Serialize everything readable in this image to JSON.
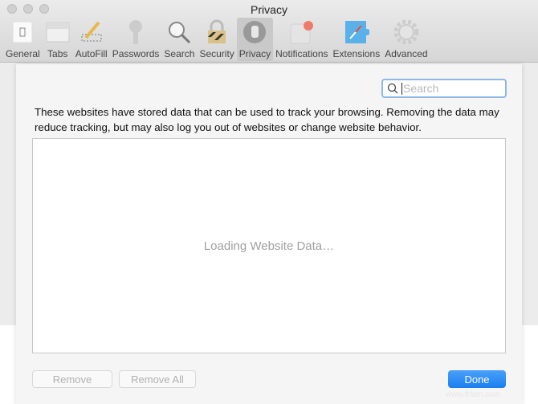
{
  "window": {
    "title": "Privacy"
  },
  "toolbar": {
    "items": [
      {
        "label": "General",
        "icon": "switch-icon"
      },
      {
        "label": "Tabs",
        "icon": "tabs-icon"
      },
      {
        "label": "AutoFill",
        "icon": "pencil-icon"
      },
      {
        "label": "Passwords",
        "icon": "key-icon"
      },
      {
        "label": "Search",
        "icon": "magnifier-icon"
      },
      {
        "label": "Security",
        "icon": "lock-icon"
      },
      {
        "label": "Privacy",
        "icon": "hand-icon",
        "active": true
      },
      {
        "label": "Notifications",
        "icon": "notification-icon"
      },
      {
        "label": "Extensions",
        "icon": "puzzle-icon"
      },
      {
        "label": "Advanced",
        "icon": "gear-icon"
      }
    ]
  },
  "sheet": {
    "search_placeholder": "Search",
    "description": "These websites have stored data that can be used to track your browsing. Removing the data may reduce tracking, but may also log you out of websites or change website behavior.",
    "loading": "Loading Website Data…",
    "remove": "Remove",
    "remove_all": "Remove All",
    "done": "Done"
  },
  "watermark": "www.frfam.com",
  "colors": {
    "accent": "#1a7ef0",
    "notification_badge": "#f07a6a"
  }
}
